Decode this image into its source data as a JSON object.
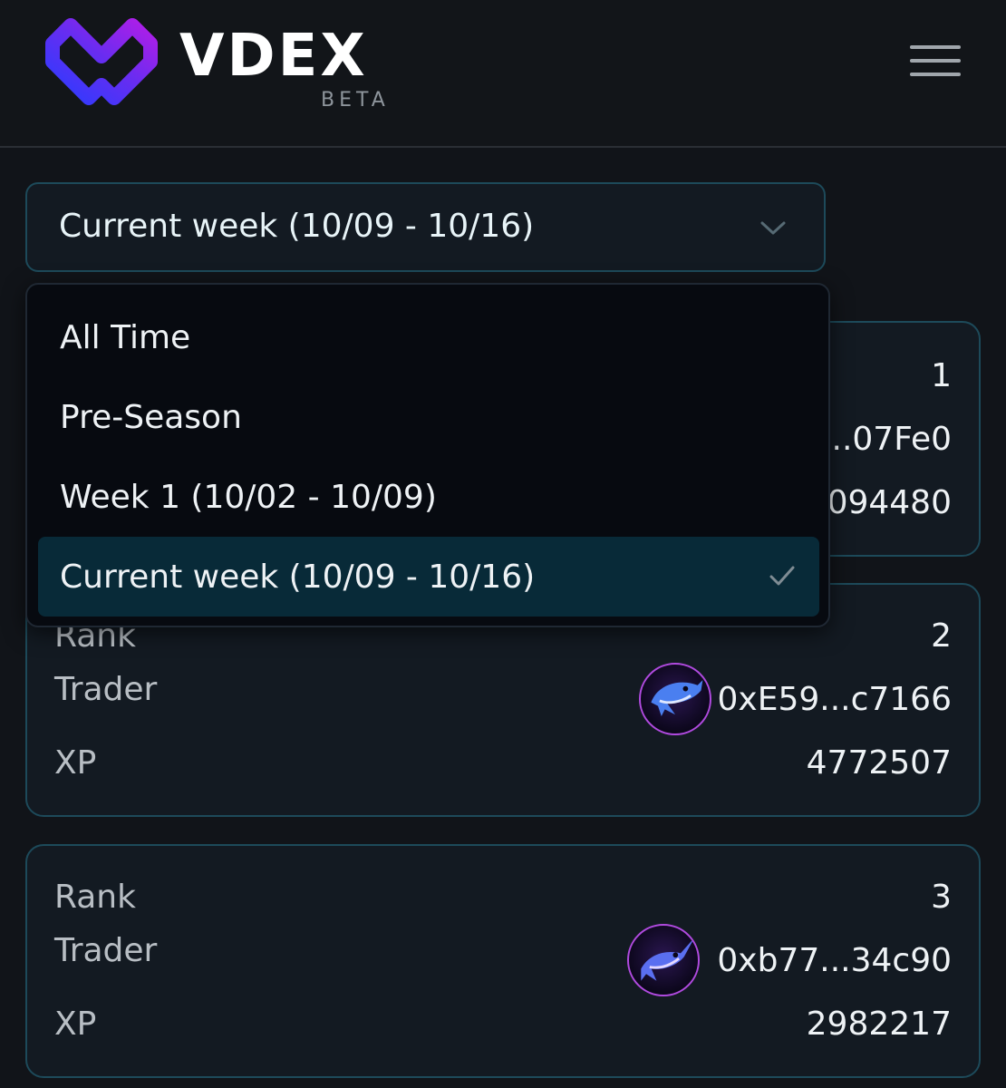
{
  "brand": {
    "name": "VDEX",
    "tag": "BETA"
  },
  "filter": {
    "selected": "Current week (10/09 - 10/16)",
    "options": [
      "All Time",
      "Pre-Season",
      "Week 1 (10/02 - 10/09)",
      "Current week (10/09 - 10/16)"
    ]
  },
  "labels": {
    "rank": "Rank",
    "trader": "Trader",
    "xp": "XP"
  },
  "leaderboard": [
    {
      "rank": "1",
      "trader": "...07Fe0",
      "xp": "094480"
    },
    {
      "rank": "2",
      "trader": "0xE59...c7166",
      "xp": "4772507"
    },
    {
      "rank": "3",
      "trader": "0xb77...34c90",
      "xp": "2982217"
    }
  ],
  "colors": {
    "background": "#111419",
    "card_border": "#1d4a5a",
    "selected_option": "#082a38",
    "logo_gradient": [
      "#2a3cff",
      "#b01ee8"
    ]
  }
}
